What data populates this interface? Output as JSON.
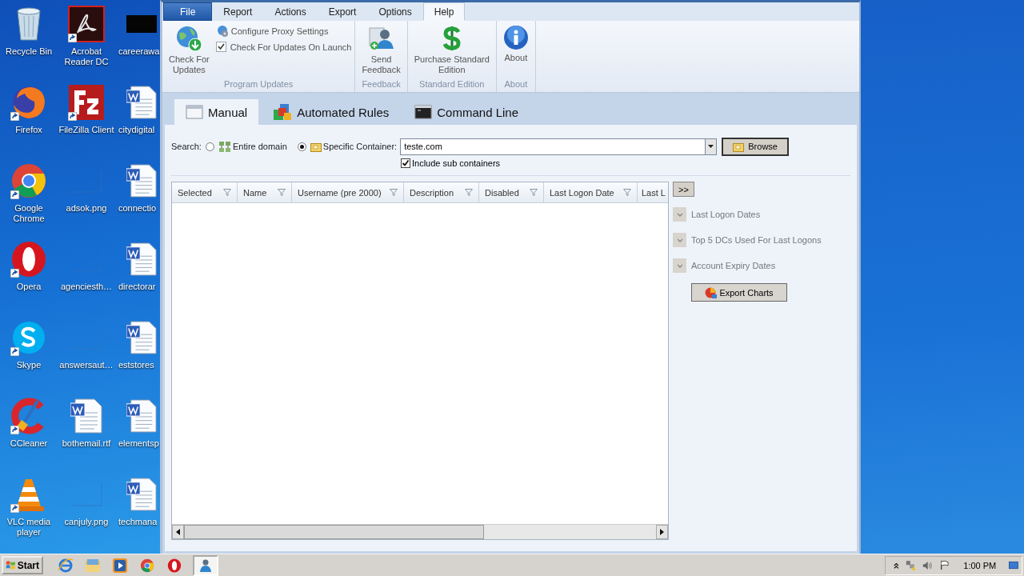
{
  "desktop": {
    "icons": [
      {
        "label": "Recycle Bin",
        "kind": "recycle-bin",
        "shortcut": false
      },
      {
        "label": "Acrobat Reader DC",
        "kind": "acrobat",
        "shortcut": true
      },
      {
        "label": "careerawa",
        "kind": "dark-file",
        "shortcut": false
      },
      {
        "label": "Firefox",
        "kind": "firefox",
        "shortcut": true
      },
      {
        "label": "FileZilla Client",
        "kind": "filezilla",
        "shortcut": true
      },
      {
        "label": "citydigital",
        "kind": "word",
        "shortcut": false
      },
      {
        "label": "Google Chrome",
        "kind": "chrome",
        "shortcut": true
      },
      {
        "label": "adsok.png",
        "kind": "blank",
        "shortcut": false
      },
      {
        "label": "connectio",
        "kind": "word",
        "shortcut": false
      },
      {
        "label": "Opera",
        "kind": "opera",
        "shortcut": true
      },
      {
        "label": "agenciesth…",
        "kind": "blank",
        "shortcut": false
      },
      {
        "label": "directorar",
        "kind": "word",
        "shortcut": false
      },
      {
        "label": "Skype",
        "kind": "skype",
        "shortcut": true
      },
      {
        "label": "answersaut…",
        "kind": "blank",
        "shortcut": false
      },
      {
        "label": "eststores",
        "kind": "word",
        "shortcut": false
      },
      {
        "label": "CCleaner",
        "kind": "ccleaner",
        "shortcut": true
      },
      {
        "label": "bothemail.rtf",
        "kind": "word",
        "shortcut": false
      },
      {
        "label": "elementsp",
        "kind": "word",
        "shortcut": false
      },
      {
        "label": "VLC media player",
        "kind": "vlc",
        "shortcut": true
      },
      {
        "label": "canjuly.png",
        "kind": "blank",
        "shortcut": false
      },
      {
        "label": "techmana",
        "kind": "word",
        "shortcut": false
      }
    ]
  },
  "ribbon": {
    "tabs": [
      {
        "label": "File",
        "kind": "application-menu",
        "selected": false
      },
      {
        "label": "Report",
        "kind": "tab",
        "selected": false
      },
      {
        "label": "Actions",
        "kind": "tab",
        "selected": false
      },
      {
        "label": "Export",
        "kind": "tab",
        "selected": false
      },
      {
        "label": "Options",
        "kind": "tab",
        "selected": false
      },
      {
        "label": "Help",
        "kind": "tab",
        "selected": true
      }
    ],
    "groups": [
      {
        "title": "Program Updates",
        "items": [
          {
            "kind": "large",
            "lines": [
              "Check For",
              "Updates"
            ]
          },
          {
            "kind": "stack",
            "items": [
              {
                "kind": "small",
                "label": "Configure Proxy Settings"
              },
              {
                "kind": "checkbox",
                "label": "Check For Updates On Launch",
                "checked": true
              }
            ]
          }
        ]
      },
      {
        "title": "Feedback",
        "items": [
          {
            "kind": "large",
            "lines": [
              "Send",
              "Feedback"
            ]
          }
        ]
      },
      {
        "title": "Standard Edition",
        "items": [
          {
            "kind": "large",
            "lines": [
              "Purchase Standard",
              "Edition"
            ]
          }
        ]
      },
      {
        "title": "About",
        "items": [
          {
            "kind": "large",
            "lines": [
              "About"
            ]
          }
        ]
      }
    ]
  },
  "main_tabs": [
    {
      "label": "Manual",
      "selected": true
    },
    {
      "label": "Automated Rules",
      "selected": false
    },
    {
      "label": "Command Line",
      "selected": false
    }
  ],
  "search": {
    "label": "Search:",
    "options": [
      {
        "label": "Entire domain",
        "selected": false
      },
      {
        "label": "Specific Container:",
        "selected": true
      }
    ],
    "container": {
      "value": "teste.com"
    },
    "browse_button": "Browse",
    "include_sub": {
      "label": "Include sub containers",
      "checked": true
    }
  },
  "table": {
    "columns": [
      "Selected",
      "Name",
      "Username (pre 2000)",
      "Description",
      "Disabled",
      "Last Logon Date",
      "Last L"
    ]
  },
  "charts_panel": {
    "toggle": ">>",
    "sections": [
      {
        "title": "Last Logon Dates",
        "expanded": false
      },
      {
        "title": "Top 5 DCs Used For Last Logons",
        "expanded": false
      },
      {
        "title": "Account Expiry Dates",
        "expanded": false
      }
    ],
    "export_button": "Export Charts"
  },
  "taskbar": {
    "start": "Start",
    "apps": [
      {
        "kind": "ie",
        "active": false
      },
      {
        "kind": "explorer",
        "active": false
      },
      {
        "kind": "media",
        "active": false
      },
      {
        "kind": "chrome",
        "active": false
      },
      {
        "kind": "opera",
        "active": false
      },
      {
        "kind": "app",
        "active": true
      }
    ],
    "clock": "1:00 PM"
  }
}
